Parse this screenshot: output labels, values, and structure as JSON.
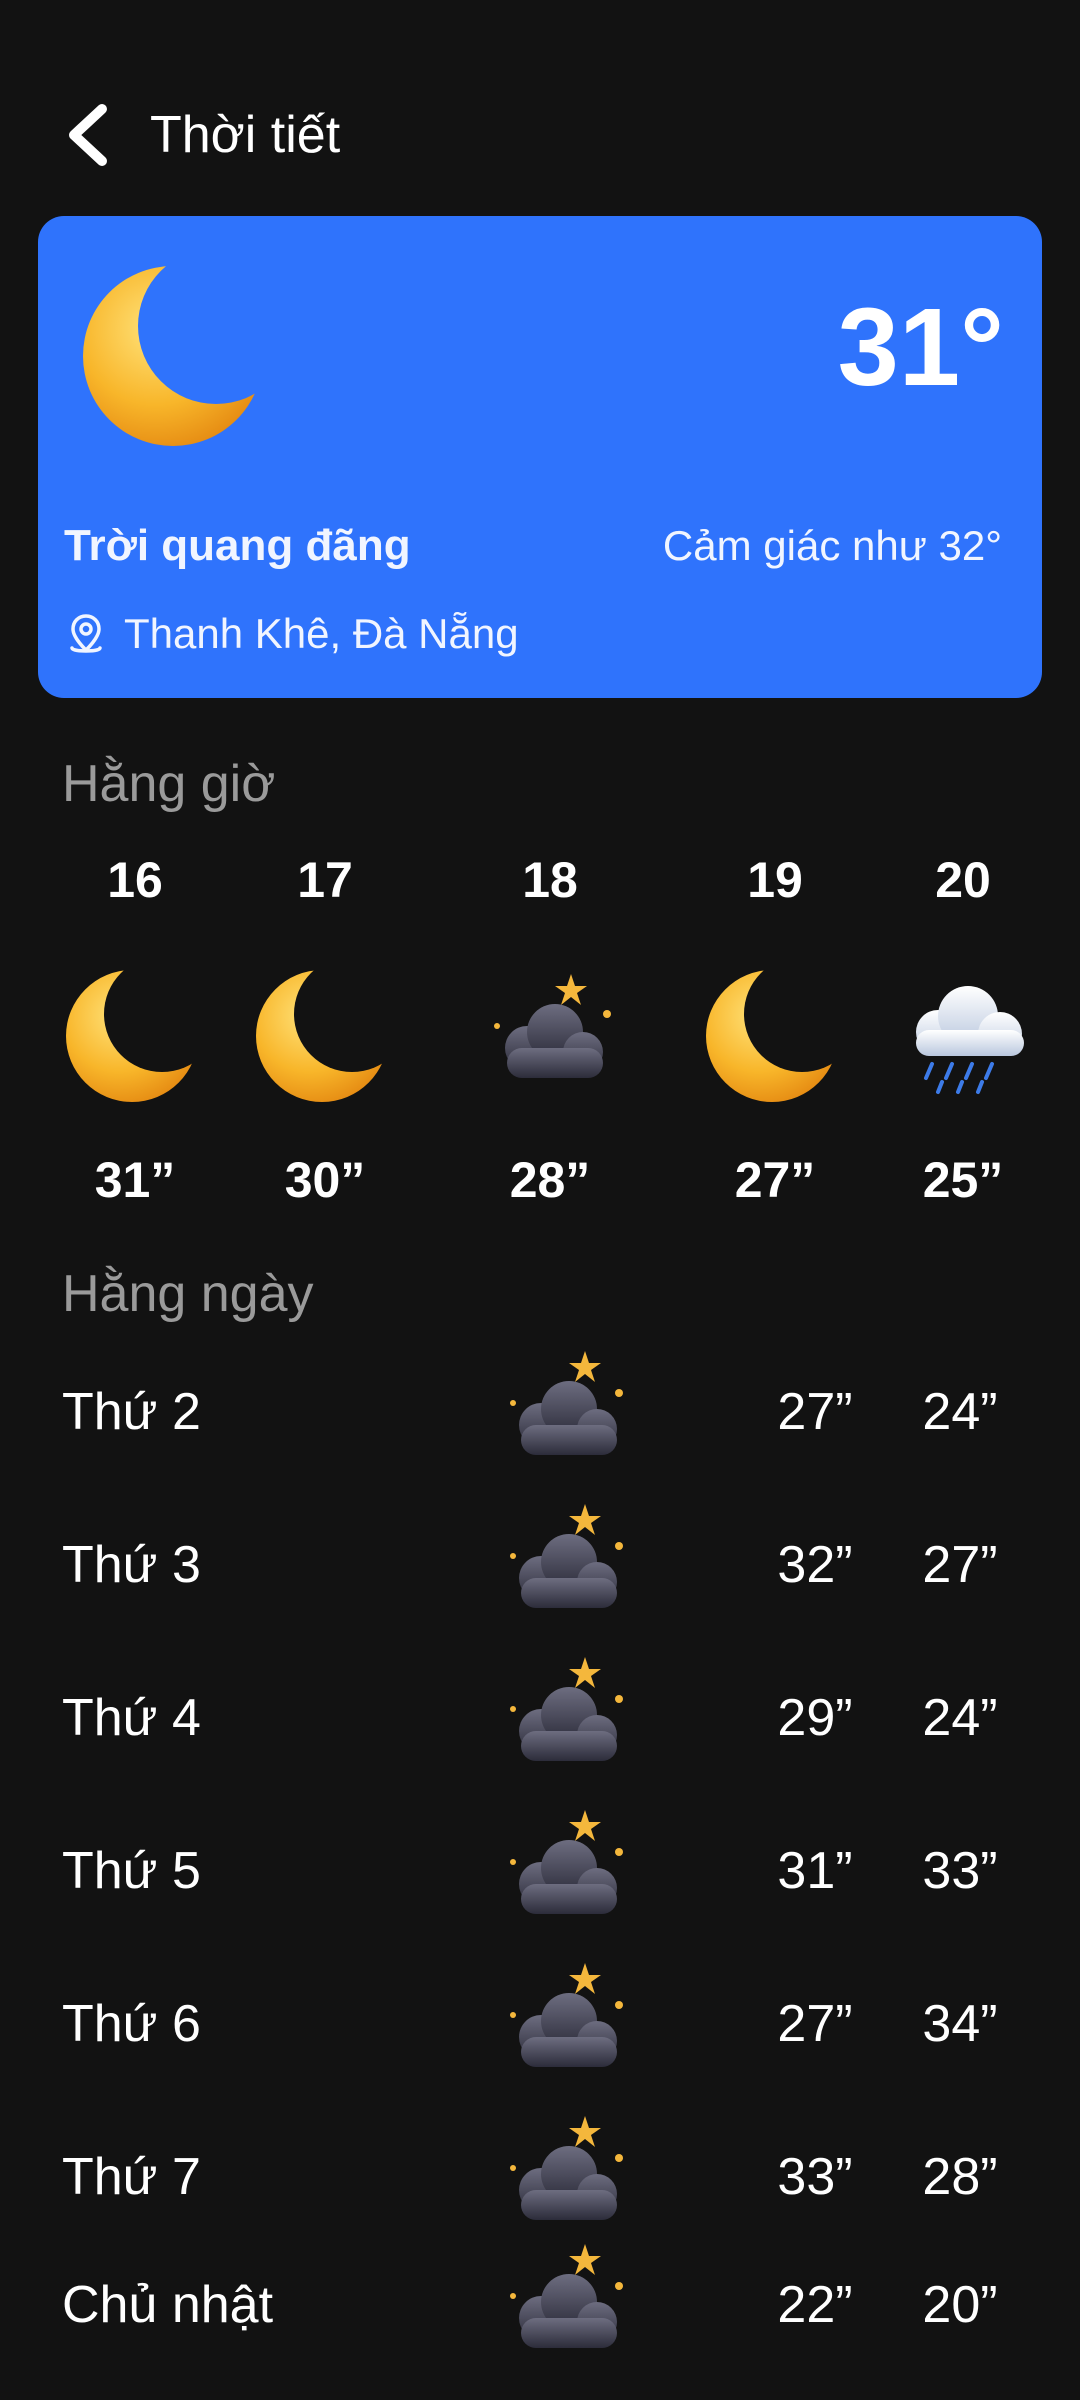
{
  "header": {
    "title": "Thời tiết",
    "back_icon": "chevron-left-icon"
  },
  "current": {
    "icon": "crescent-moon-icon",
    "temperature": "31°",
    "condition": "Trời quang đãng",
    "feels_like": "Cảm giác như 32°",
    "location_icon": "location-pin-icon",
    "location": "Thanh Khê, Đà Nẵng"
  },
  "hourly": {
    "title": "Hằng giờ",
    "items": [
      {
        "time": "16",
        "icon": "crescent-moon-icon",
        "temp": "31”"
      },
      {
        "time": "17",
        "icon": "crescent-moon-icon",
        "temp": "30”"
      },
      {
        "time": "18",
        "icon": "cloudy-night-icon",
        "temp": "28”"
      },
      {
        "time": "19",
        "icon": "crescent-moon-icon",
        "temp": "27”"
      },
      {
        "time": "20",
        "icon": "rain-cloud-icon",
        "temp": "25”"
      }
    ]
  },
  "daily": {
    "title": "Hằng ngày",
    "items": [
      {
        "day": "Thứ 2",
        "icon": "cloudy-night-icon",
        "high": "27”",
        "low": "24”"
      },
      {
        "day": "Thứ 3",
        "icon": "cloudy-night-icon",
        "high": "32”",
        "low": "27”"
      },
      {
        "day": "Thứ 4",
        "icon": "cloudy-night-icon",
        "high": "29”",
        "low": "24”"
      },
      {
        "day": "Thứ 5",
        "icon": "cloudy-night-icon",
        "high": "31”",
        "low": "33”"
      },
      {
        "day": "Thứ 6",
        "icon": "cloudy-night-icon",
        "high": "27”",
        "low": "34”"
      },
      {
        "day": "Thứ 7",
        "icon": "cloudy-night-icon",
        "high": "33”",
        "low": "28”"
      },
      {
        "day": "Chủ nhật",
        "icon": "cloudy-night-icon",
        "high": "22”",
        "low": "20”"
      }
    ]
  },
  "colors": {
    "background": "#121212",
    "card": "#2f73fc",
    "section_title": "#9a9a9a",
    "moon": "#f8b62a"
  }
}
